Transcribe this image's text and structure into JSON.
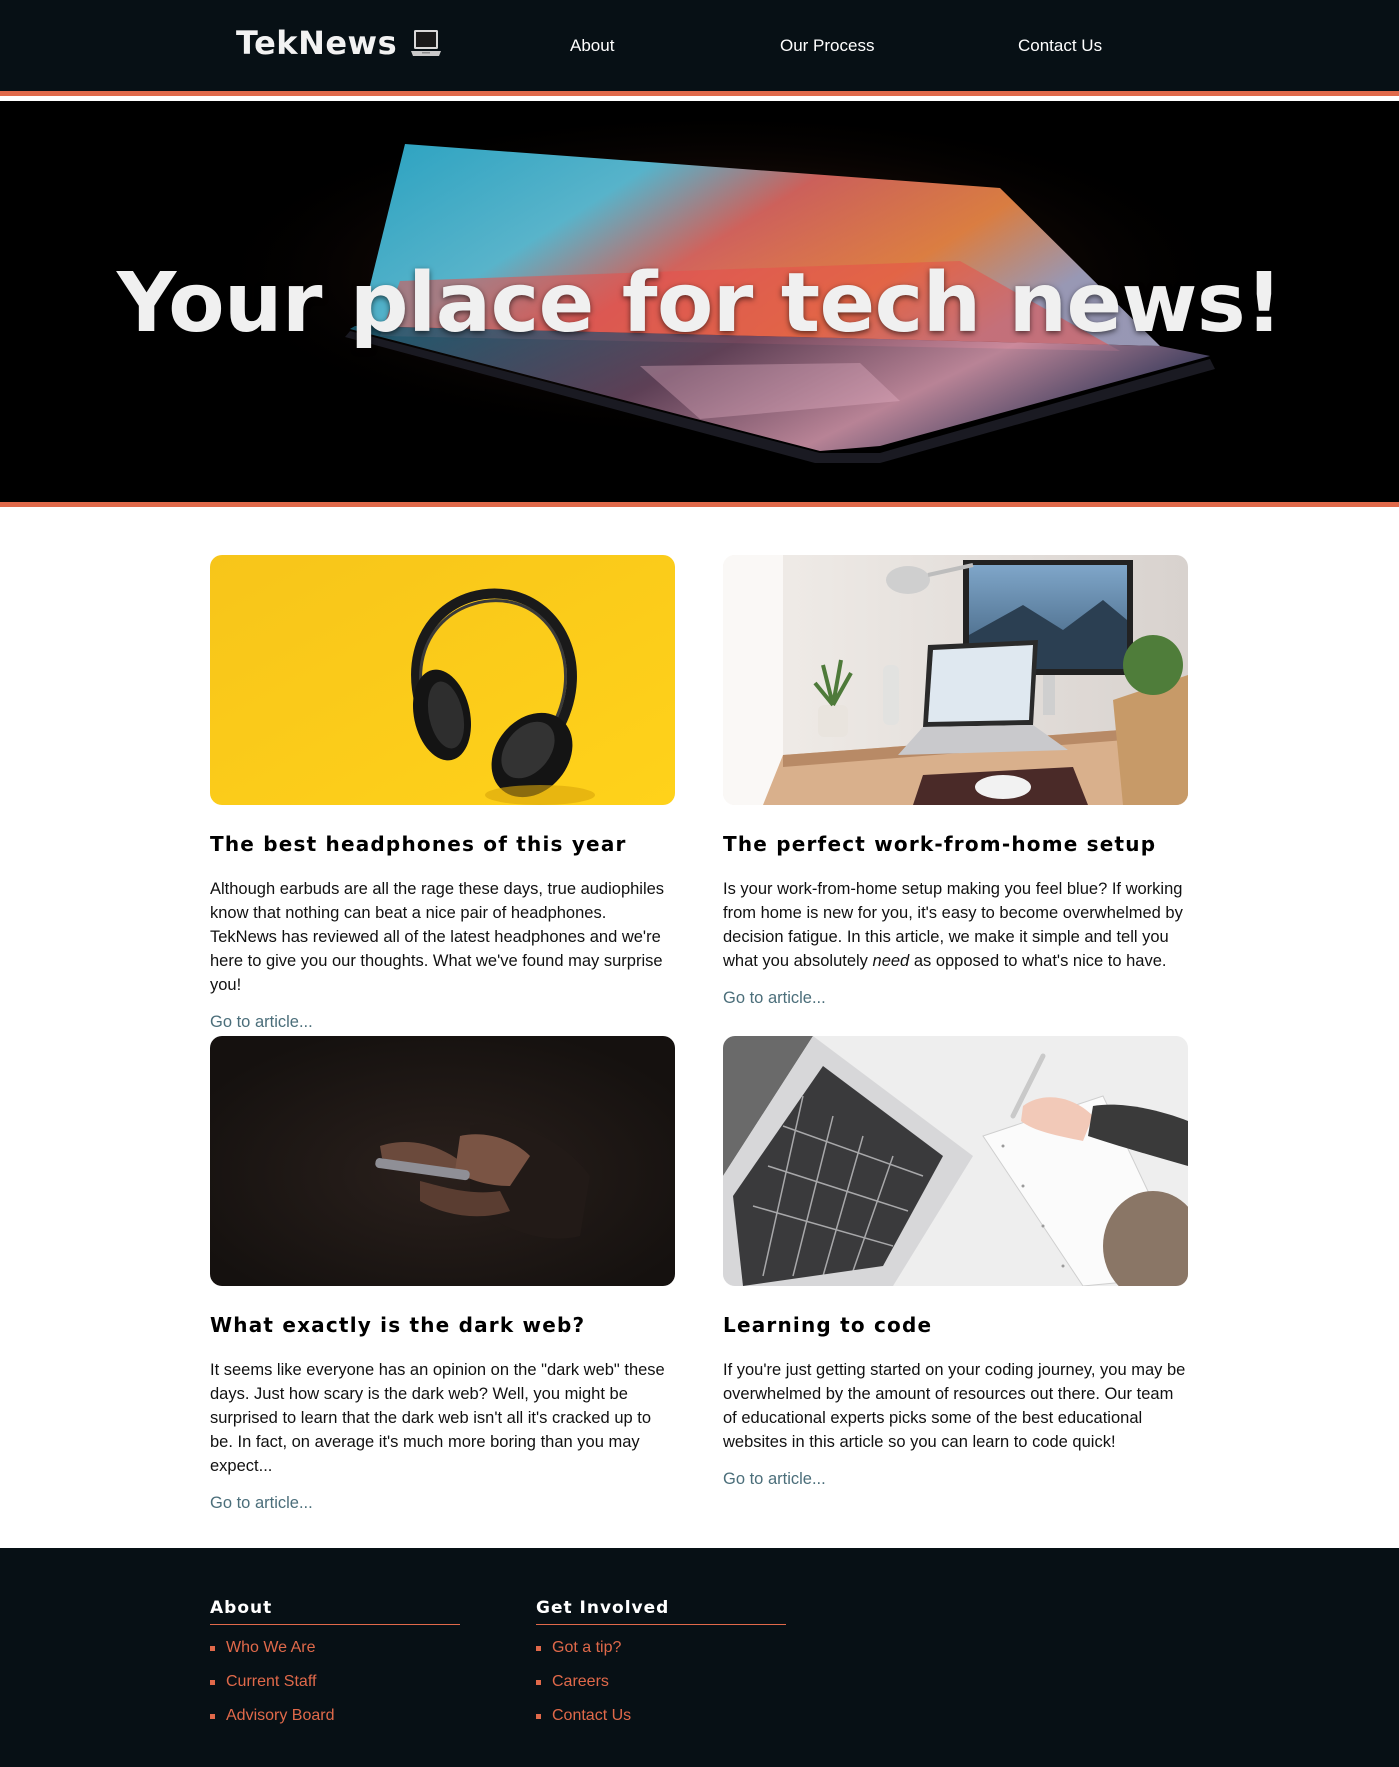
{
  "header": {
    "logo_text": "TekNews",
    "nav": [
      {
        "label": "About"
      },
      {
        "label": "Our Process"
      },
      {
        "label": "Contact Us"
      }
    ]
  },
  "hero": {
    "title": "Your place for tech news!"
  },
  "articles": [
    {
      "title": "The best headphones of this year",
      "text": "Although earbuds are all the rage these days, true audiophiles know that nothing can beat a nice pair of headphones. TekNews has reviewed all of the latest headphones and we're here to give you our thoughts. What we've found may surprise you!",
      "link": "Go to article..."
    },
    {
      "title": "The perfect work-from-home setup",
      "text_before": "Is your work-from-home setup making you feel blue? If working from home is new for you, it's easy to become overwhelmed by decision fatigue. In this article, we make it simple and tell you what you absolutely ",
      "text_em": "need",
      "text_after": " as opposed to what's nice to have.",
      "link": "Go to article..."
    },
    {
      "title": "What exactly is the dark web?",
      "text": "It seems like everyone has an opinion on the \"dark web\" these days. Just how scary is the dark web? Well, you might be surprised to learn that the dark web isn't all it's cracked up to be. In fact, on average it's much more boring than you may expect...",
      "link": "Go to article..."
    },
    {
      "title": "Learning to code",
      "text": "If you're just getting started on your coding journey, you may be overwhelmed by the amount of resources out there. Our team of educational experts picks some of the best educational websites in this article so you can learn to code quick!",
      "link": "Go to article..."
    }
  ],
  "footer": {
    "about": {
      "title": "About",
      "items": [
        "Who We Are",
        "Current Staff",
        "Advisory Board"
      ]
    },
    "get_involved": {
      "title": "Get Involved",
      "items": [
        "Got a tip?",
        "Careers",
        "Contact Us"
      ]
    }
  },
  "colors": {
    "accent": "#e0694a",
    "dark_bg": "#071015",
    "link": "#4b6e7a"
  },
  "icons": {
    "logo": "laptop-icon"
  }
}
